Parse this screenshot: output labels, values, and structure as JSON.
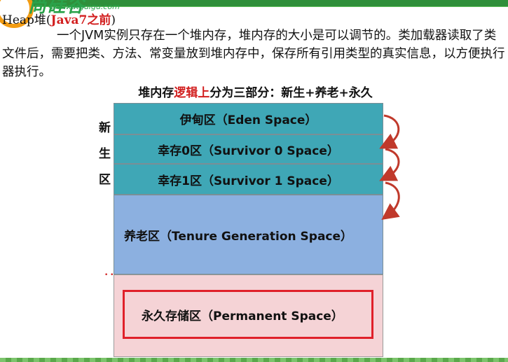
{
  "header": {
    "logo_text": "尚硅谷",
    "logo_url": "www.atguigu.com"
  },
  "title": {
    "prefix": "Heap堆(",
    "highlight": "Java7之前",
    "suffix": ")"
  },
  "paragraph": "一个JVM实例只存在一个堆内存，堆内存的大小是可以调节的。类加载器读取了类文件后，需要把类、方法、常变量放到堆内存中，保存所有引用类型的真实信息，以方便执行器执行。",
  "subheading": {
    "before": "堆内存",
    "highlight": "逻辑上",
    "after": "分为三部分：新生+养老+永久"
  },
  "young_label": [
    "新",
    "生",
    "区"
  ],
  "regions": {
    "eden": "伊甸区（Eden Space）",
    "survivor0": "幸存0区（Survivor 0 Space）",
    "survivor1": "幸存1区（Survivor 1 Space）",
    "tenure": "养老区（Tenure Generation Space）",
    "permanent": "永久存储区（Permanent Space）"
  },
  "colors": {
    "young_gen": "#3fa7b6",
    "old_gen": "#8cb0e0",
    "perm_gen": "#f5d3d6",
    "highlight_red": "#d21f1f",
    "arrow_red": "#c0392b"
  },
  "icons": {
    "transition_arrows": "curved-arrow-icon"
  }
}
